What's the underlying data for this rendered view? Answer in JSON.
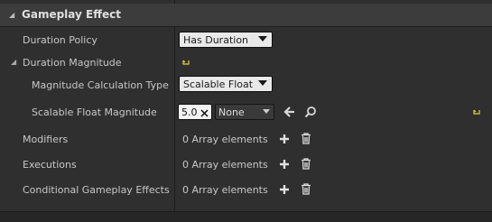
{
  "section": {
    "title": "Gameplay Effect"
  },
  "duration_policy": {
    "label": "Duration Policy",
    "value": "Has Duration"
  },
  "duration_magnitude": {
    "label": "Duration Magnitude"
  },
  "magnitude_calc_type": {
    "label": "Magnitude Calculation Type",
    "value": "Scalable Float"
  },
  "scalable_float": {
    "label": "Scalable Float Magnitude",
    "value": "5.0",
    "curve_value": "None"
  },
  "modifiers": {
    "label": "Modifiers",
    "count_text": "0 Array elements"
  },
  "executions": {
    "label": "Executions",
    "count_text": "0 Array elements"
  },
  "conditional_effects": {
    "label": "Conditional Gameplay Effects",
    "count_text": "0 Array elements"
  },
  "colors": {
    "panel_bg": "#2f2f2f",
    "header_bg": "#3c3c3c",
    "reset_yellow": "#e6d23c",
    "combo_bg": "#e9e9e9"
  }
}
